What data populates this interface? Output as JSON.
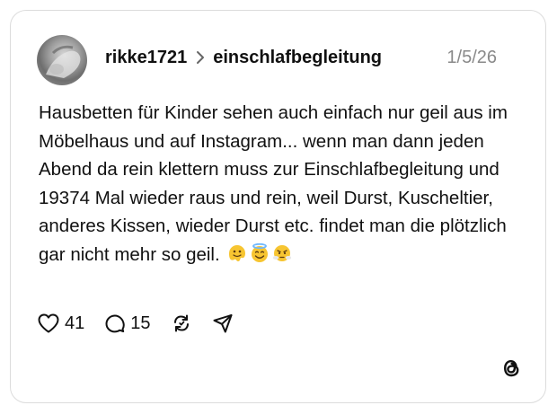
{
  "post": {
    "username": "rikke1721",
    "community": "einschlafbegleitung",
    "date": "1/5/26",
    "text": "Hausbetten für Kinder sehen auch einfach nur geil aus im Möbelhaus und auf Instagram... wenn man dann jeden Abend da rein klettern muss zur Einschlafbegleitung und 19374 Mal wieder raus und rein, weil Durst, Kuscheltier, anderes Kissen, wieder Durst etc. findet man die plötzlich gar nicht mehr so geil.",
    "emojis": [
      "melting-face-emoji",
      "smiling-face-with-halo-emoji",
      "face-with-steam-emoji"
    ]
  },
  "actions": {
    "likes": "41",
    "replies": "15"
  },
  "icons": [
    "heart-icon",
    "comment-icon",
    "repost-icon",
    "share-icon",
    "threads-logo-icon",
    "chevron-right-icon"
  ]
}
